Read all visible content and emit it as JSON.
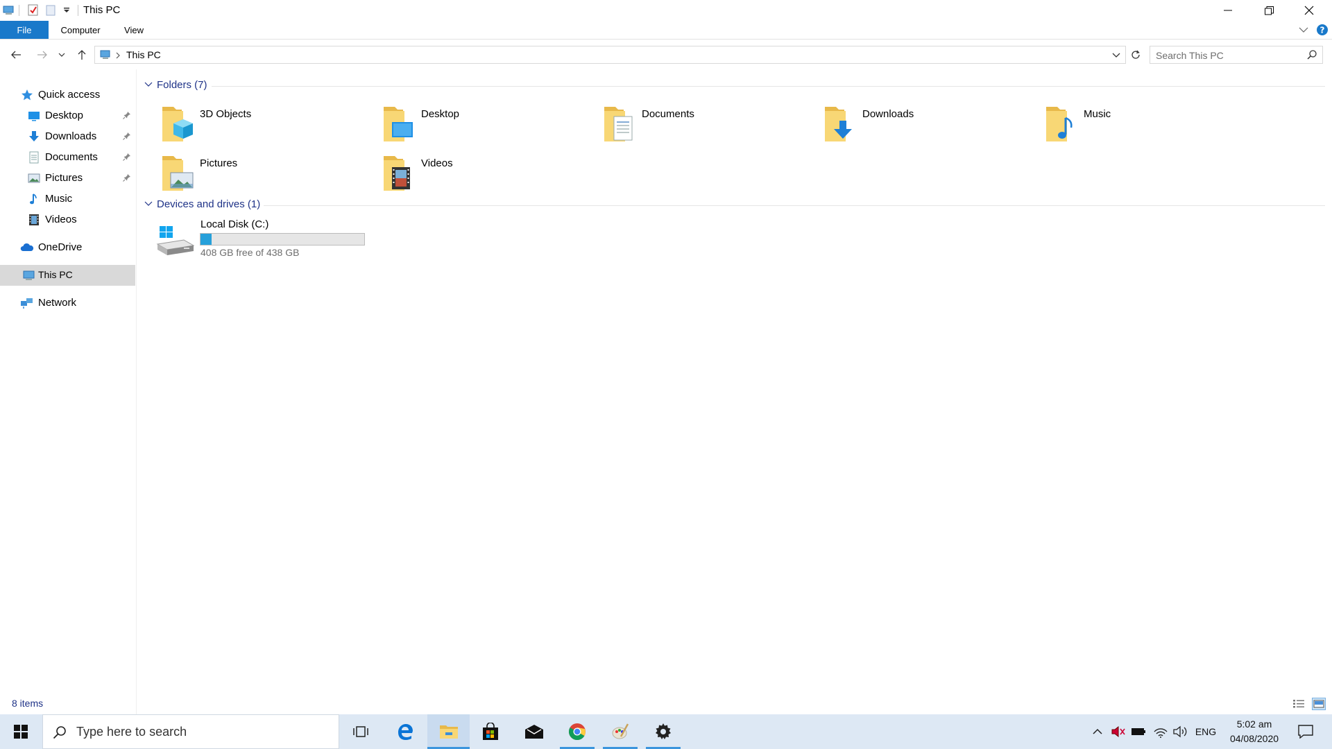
{
  "window": {
    "title": "This PC"
  },
  "ribbon": {
    "tabs": [
      "File",
      "Computer",
      "View"
    ]
  },
  "address": {
    "path": "This PC"
  },
  "search": {
    "placeholder": "Search This PC"
  },
  "nav": {
    "quick_access": "Quick access",
    "quick_items": [
      {
        "label": "Desktop",
        "pinned": true
      },
      {
        "label": "Downloads",
        "pinned": true
      },
      {
        "label": "Documents",
        "pinned": true
      },
      {
        "label": "Pictures",
        "pinned": true
      },
      {
        "label": "Music",
        "pinned": false
      },
      {
        "label": "Videos",
        "pinned": false
      }
    ],
    "onedrive": "OneDrive",
    "this_pc": "This PC",
    "network": "Network"
  },
  "content": {
    "folders_header": "Folders (7)",
    "folders": [
      "3D Objects",
      "Desktop",
      "Documents",
      "Downloads",
      "Music",
      "Pictures",
      "Videos"
    ],
    "drives_header": "Devices and drives (1)",
    "drive": {
      "name": "Local Disk (C:)",
      "free_text": "408 GB free of 438 GB",
      "used_fraction": 0.068
    }
  },
  "status": {
    "items": "8 items"
  },
  "taskbar": {
    "search_placeholder": "Type here to search",
    "language": "ENG",
    "time": "5:02 am",
    "date": "04/08/2020"
  },
  "colors": {
    "accent": "#1979ca",
    "folder": "#f8d775",
    "link": "#1e3287",
    "drive_fill": "#26a0da"
  }
}
